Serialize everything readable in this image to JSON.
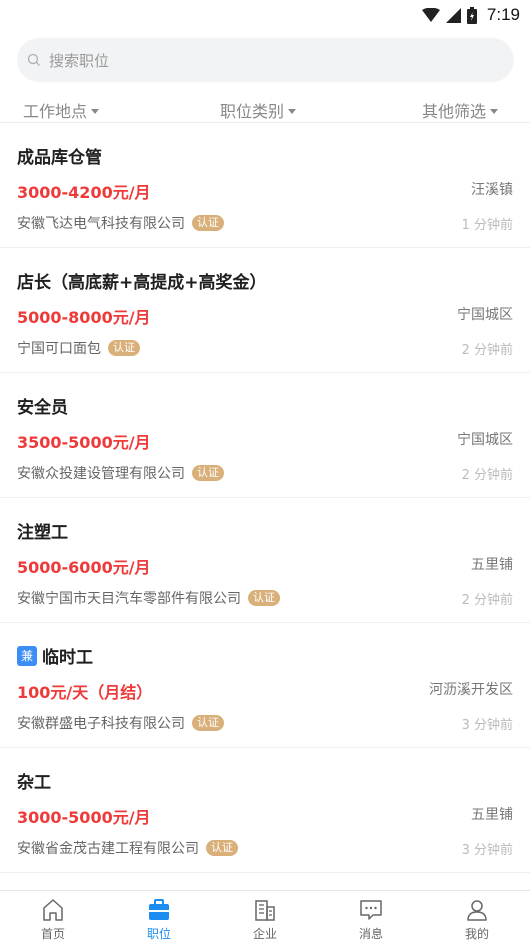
{
  "status_bar": {
    "time": "7:19"
  },
  "search": {
    "placeholder": "搜索职位"
  },
  "filters": [
    {
      "label": "工作地点"
    },
    {
      "label": "职位类别"
    },
    {
      "label": "其他筛选"
    }
  ],
  "badge_label": "认证",
  "jobs": [
    {
      "title": "成品库仓管",
      "tag": "",
      "salary": "3000-4200元/月",
      "location": "汪溪镇",
      "company": "安徽飞达电气科技有限公司",
      "time": "1 分钟前"
    },
    {
      "title": "店长（高底薪+高提成+高奖金）",
      "tag": "",
      "salary": "5000-8000元/月",
      "location": "宁国城区",
      "company": "宁国可口面包",
      "time": "2 分钟前"
    },
    {
      "title": "安全员",
      "tag": "",
      "salary": "3500-5000元/月",
      "location": "宁国城区",
      "company": "安徽众投建设管理有限公司",
      "time": "2 分钟前"
    },
    {
      "title": "注塑工",
      "tag": "",
      "salary": "5000-6000元/月",
      "location": "五里铺",
      "company": "安徽宁国市天目汽车零部件有限公司",
      "time": "2 分钟前"
    },
    {
      "title": "临时工",
      "tag": "兼",
      "salary": "100元/天（月结）",
      "location": "河沥溪开发区",
      "company": "安徽群盛电子科技有限公司",
      "time": "3 分钟前"
    },
    {
      "title": "杂工",
      "tag": "",
      "salary": "3000-5000元/月",
      "location": "五里铺",
      "company": "安徽省金茂古建工程有限公司",
      "time": "3 分钟前"
    }
  ],
  "bottom_nav": [
    {
      "label": "首页",
      "icon": "home-icon"
    },
    {
      "label": "职位",
      "icon": "briefcase-icon",
      "active": true
    },
    {
      "label": "企业",
      "icon": "building-icon"
    },
    {
      "label": "消息",
      "icon": "message-icon"
    },
    {
      "label": "我的",
      "icon": "user-icon"
    }
  ],
  "colors": {
    "accent": "#1b8cf2",
    "salary": "#ef3a3a",
    "badge": "#d9b07a",
    "part_time_tag": "#3b8ef5"
  }
}
